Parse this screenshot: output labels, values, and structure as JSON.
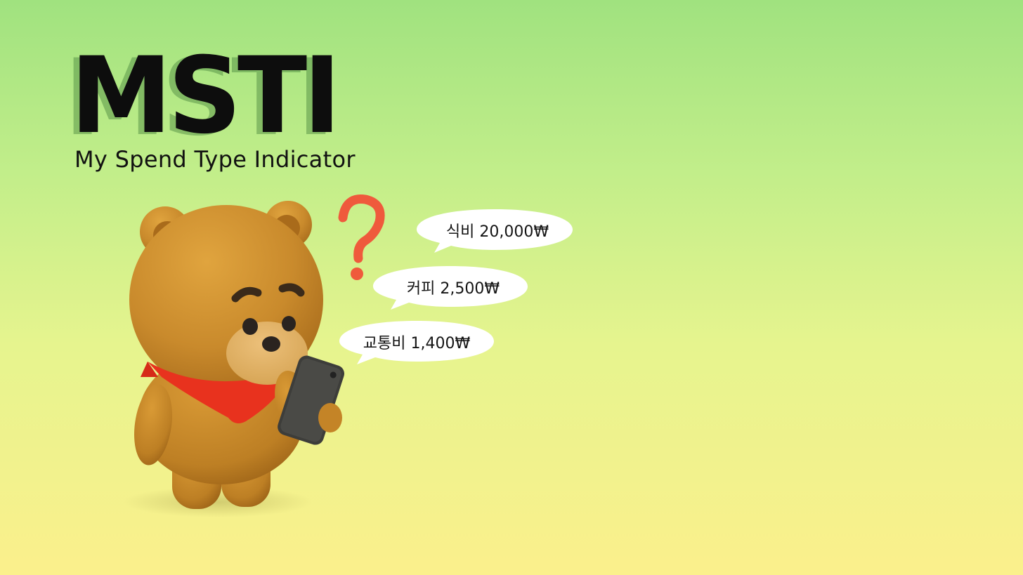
{
  "title": "MSTI",
  "subtitle": "My Spend Type Indicator",
  "illustration": {
    "character": "bear-character",
    "accessory": "red-bandana",
    "device": "smartphone",
    "question_mark_color": "#ef5a3c"
  },
  "bubbles": [
    {
      "text": "식비 20,000₩"
    },
    {
      "text": "커피 2,500₩"
    },
    {
      "text": "교통비 1,400₩"
    }
  ],
  "colors": {
    "background_top": "#a0e27f",
    "background_bottom": "#fbf08c",
    "bear_fur": "#c98a2c",
    "bear_muzzle": "#e2b265",
    "bandana": "#e8321e",
    "phone": "#3d3d3a"
  }
}
